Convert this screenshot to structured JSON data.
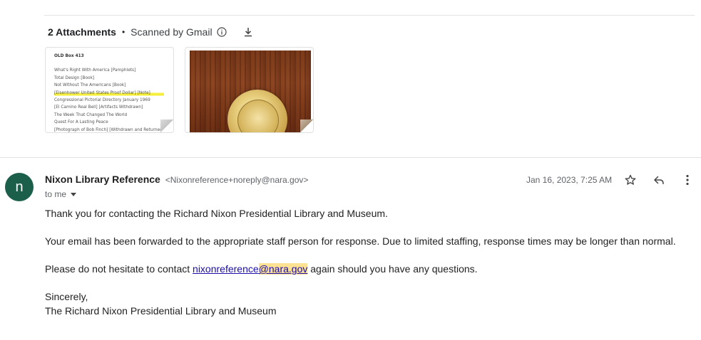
{
  "attachments": {
    "count_label": "2 Attachments",
    "separator": "•",
    "scanned_label": "Scanned by Gmail",
    "doc_thumbnail": {
      "title": "OLD Box 413",
      "lines": [
        "What's Right With America [Pamphlets]",
        "Total Design [Book]",
        "Not Without The Americans [Book]",
        "[Eisenhower United States Proof Dollar] [Note]",
        "Congressional Pictorial Directory January 1969",
        "[El Camino Real Bell] [Artifacts Withdrawn]",
        "The Week That Changed The World",
        "Quest For A Lasting Peace",
        "[Photograph of Bob Finch] [Withdrawn and Returned]"
      ],
      "highlighted_line_index": 3
    }
  },
  "message": {
    "avatar_letter": "n",
    "avatar_color": "#1b5e4a",
    "sender_name": "Nixon Library Reference",
    "sender_email": "<Nixonreference+noreply@nara.gov>",
    "recipient": "to me",
    "date": "Jan 16, 2023, 7:25 AM",
    "body": {
      "p1": "Thank you for contacting the Richard Nixon Presidential Library and Museum.",
      "p2": "Your email has been forwarded to the appropriate staff person for response. Due to limited staffing, response times may be longer than normal.",
      "p3_before": "Please do not hesitate to contact ",
      "p3_link_a": "nixonreference",
      "p3_link_b": "@nara.gov",
      "p3_after": " again should you have any questions.",
      "closing": "Sincerely,",
      "signature": "The Richard Nixon Presidential Library and Museum"
    }
  },
  "icons": {
    "info": "info-icon",
    "download": "download-icon",
    "star": "star-icon",
    "reply": "reply-icon",
    "more": "more-vert-icon"
  }
}
